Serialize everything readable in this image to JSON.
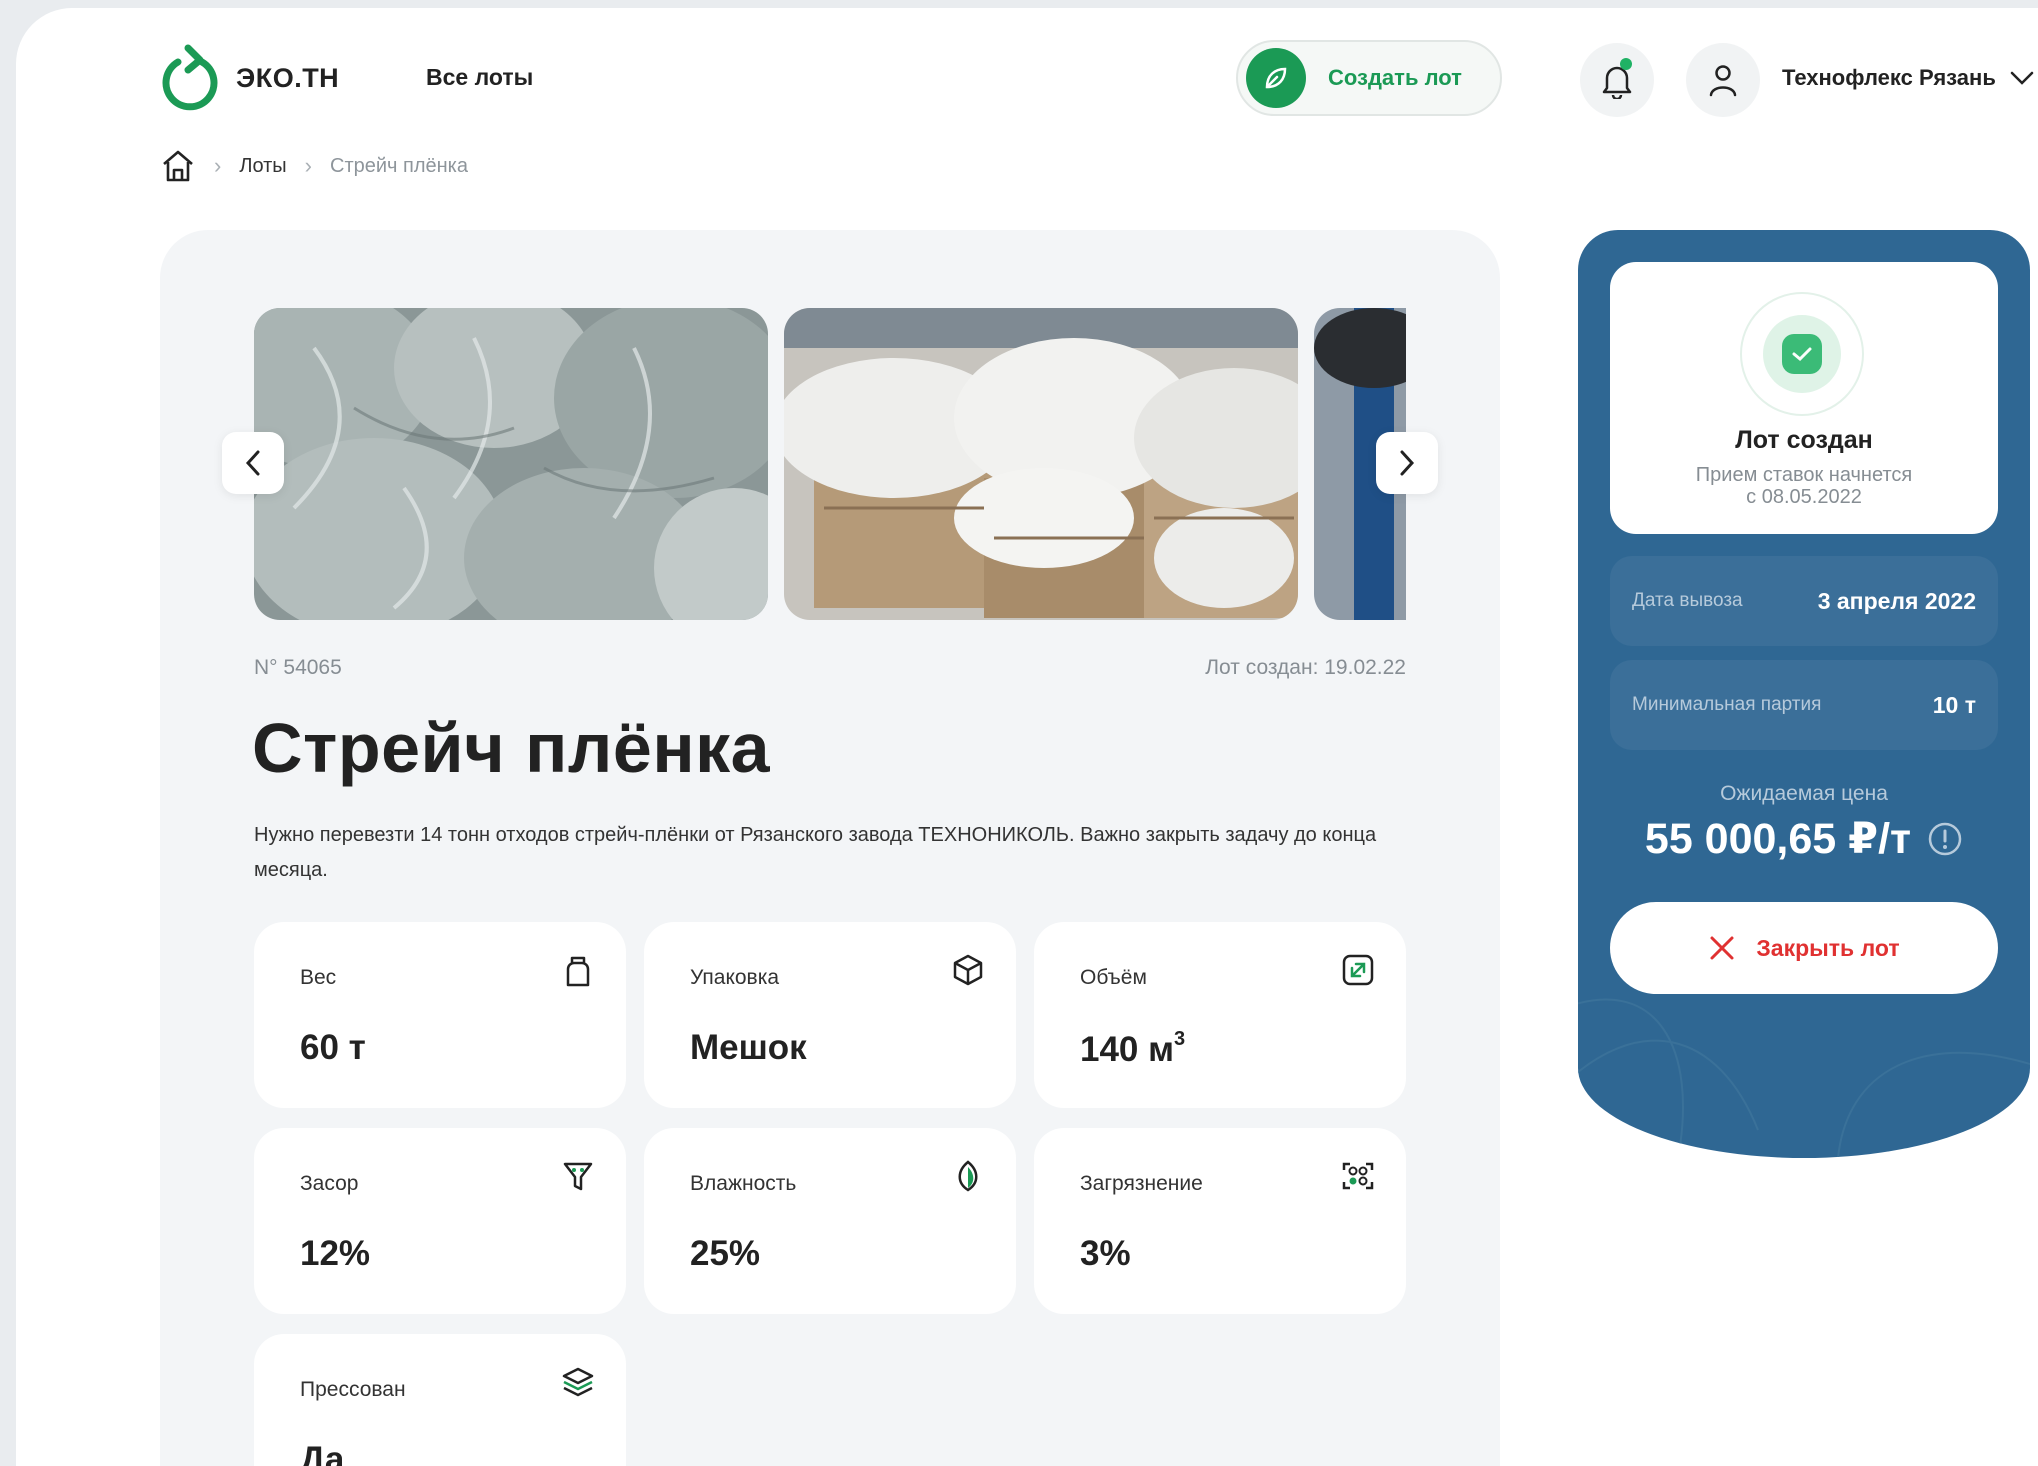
{
  "header": {
    "logo_text": "ЭКО.ТН",
    "nav_all_lots": "Все лоты",
    "create_lot_label": "Создать лот",
    "user_name": "Технофлекс Рязань"
  },
  "breadcrumb": {
    "items": [
      "Лоты",
      "Стрейч плёнка"
    ]
  },
  "lot": {
    "number": "N° 54065",
    "created": "Лот создан: 19.02.22",
    "title": "Стрейч плёнка",
    "description": "Нужно перевезти 14 тонн отходов стрейч-плёнки от Рязанского завода ТЕХНОНИКОЛЬ. Важно закрыть задачу до конца месяца.",
    "params": [
      {
        "label": "Вес",
        "value": "60 т",
        "icon": "weight-bag-icon"
      },
      {
        "label": "Упаковка",
        "value": "Мешок",
        "icon": "box-icon"
      },
      {
        "label": "Объём",
        "value": "140 м",
        "value_sup": "3",
        "icon": "expand-icon"
      },
      {
        "label": "Засор",
        "value": "12%",
        "icon": "filter-icon"
      },
      {
        "label": "Влажность",
        "value": "25%",
        "icon": "leaf-icon"
      },
      {
        "label": "Загрязнение",
        "value": "3%",
        "icon": "scan-icon"
      },
      {
        "label": "Прессован",
        "value": "Да",
        "icon": "layers-icon"
      }
    ]
  },
  "side": {
    "status_title": "Лот создан",
    "status_sub_1": "Прием ставок начнется",
    "status_sub_2": "с 08.05.2022",
    "pickup_label": "Дата вывоза",
    "pickup_value": "3 апреля 2022",
    "min_batch_label": "Минимальная партия",
    "min_batch_value": "10 т",
    "price_label": "Ожидаемая цена",
    "price_value": "55 000,65 ₽/т",
    "close_label": "Закрыть лот"
  },
  "colors": {
    "accent_green": "#1b9a55",
    "panel_blue": "#2f6793",
    "danger_red": "#e03131"
  }
}
